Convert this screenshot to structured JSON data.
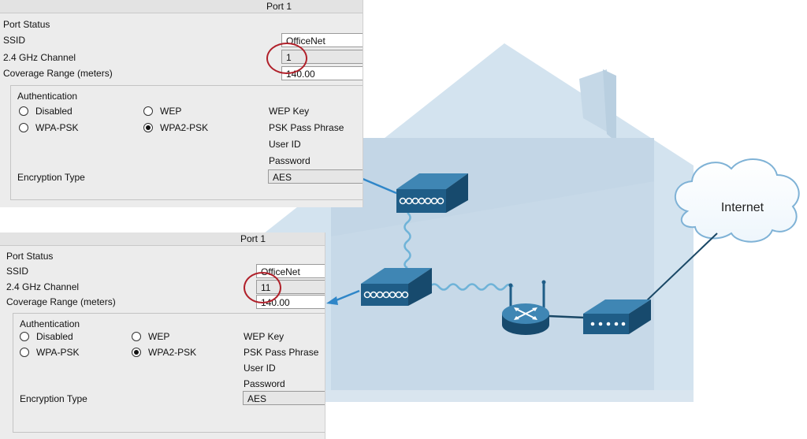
{
  "cloud_label": "Internet",
  "panels": [
    {
      "title": "Port 1",
      "port_status": "Port Status",
      "ssid_label": "SSID",
      "ssid_value": "OfficeNet",
      "channel_label": "2.4 GHz Channel",
      "channel_value": "1",
      "coverage_label": "Coverage Range (meters)",
      "coverage_value": "140.00",
      "authentication": "Authentication",
      "opt_disabled": "Disabled",
      "opt_wep": "WEP",
      "opt_wpa_psk": "WPA-PSK",
      "opt_wpa2_psk": "WPA2-PSK",
      "selected_auth": "WPA2-PSK",
      "wep_key": "WEP Key",
      "psk_pass": "PSK Pass Phrase",
      "user_id": "User ID",
      "password": "Password",
      "encryption_label": "Encryption Type",
      "encryption_value": "AES"
    },
    {
      "title": "Port 1",
      "port_status": "Port Status",
      "ssid_label": "SSID",
      "ssid_value": "OfficeNet",
      "channel_label": "2.4 GHz Channel",
      "channel_value": "11",
      "coverage_label": "Coverage Range (meters)",
      "coverage_value": "140.00",
      "authentication": "Authentication",
      "opt_disabled": "Disabled",
      "opt_wep": "WEP",
      "opt_wpa_psk": "WPA-PSK",
      "opt_wpa2_psk": "WPA2-PSK",
      "selected_auth": "WPA2-PSK",
      "wep_key": "WEP Key",
      "psk_pass": "PSK Pass Phrase",
      "user_id": "User ID",
      "password": "Password",
      "encryption_label": "Encryption Type",
      "encryption_value": "AES"
    }
  ],
  "colors": {
    "house": "#d3e3ef",
    "house_shade": "#c3d6e6",
    "device": "#1f5d87",
    "device_top": "#3f86b4",
    "link": "#1a4866",
    "arrow": "#2f86c8",
    "highlight": "#b0202a"
  }
}
